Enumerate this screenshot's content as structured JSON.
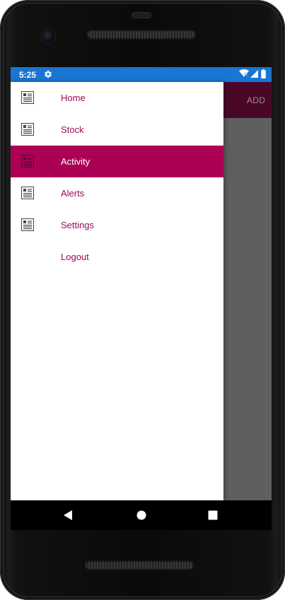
{
  "status_bar": {
    "time": "5:25",
    "background": "#1976d2",
    "icons": [
      "gear-icon",
      "wifi-icon",
      "signal-icon",
      "battery-icon"
    ]
  },
  "toolbar": {
    "add_label": "ADD",
    "background": "#4a0828"
  },
  "drawer": {
    "accent": "#ac0055",
    "text_color": "#9b0b56",
    "selected_index": 2,
    "items": [
      {
        "label": "Home",
        "icon": "list-icon"
      },
      {
        "label": "Stock",
        "icon": "list-icon"
      },
      {
        "label": "Activity",
        "icon": "list-icon"
      },
      {
        "label": "Alerts",
        "icon": "list-icon"
      },
      {
        "label": "Settings",
        "icon": "list-icon"
      },
      {
        "label": "Logout",
        "icon": ""
      }
    ]
  },
  "navigation_bar": {
    "buttons": [
      "back-icon",
      "home-icon",
      "recents-icon"
    ]
  }
}
